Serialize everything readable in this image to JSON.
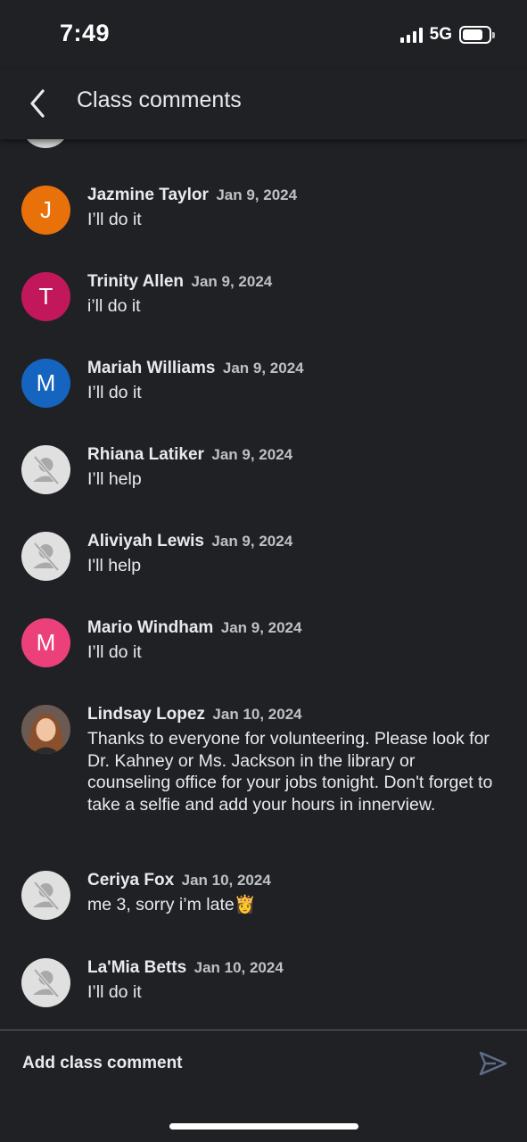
{
  "status_bar": {
    "time": "7:49",
    "network": "5G",
    "icons": [
      "signal-icon",
      "battery-icon"
    ]
  },
  "header": {
    "title": "Class comments",
    "back_icon": "chevron-left-icon"
  },
  "comments": [
    {
      "author": "Jazmine Taylor",
      "date": "Jan 9, 2024",
      "text": "I’ll do it",
      "avatar_letter": "J",
      "avatar_color": "#e8710a"
    },
    {
      "author": "Trinity Allen",
      "date": "Jan 9, 2024",
      "text": "i’ll do it",
      "avatar_letter": "T",
      "avatar_color": "#c2185b"
    },
    {
      "author": "Mariah Williams",
      "date": "Jan 9, 2024",
      "text": "I’ll do it",
      "avatar_letter": "M",
      "avatar_color": "#1565c0"
    },
    {
      "author": "Rhiana Latiker",
      "date": "Jan 9, 2024",
      "text": "I’ll help",
      "avatar_icon": "no-photo-icon"
    },
    {
      "author": "Aliviyah Lewis",
      "date": "Jan 9, 2024",
      "text": "I'll help",
      "avatar_icon": "no-photo-icon"
    },
    {
      "author": "Mario Windham",
      "date": "Jan 9, 2024",
      "text": "I’ll do it",
      "avatar_letter": "M",
      "avatar_color": "#ec407a"
    },
    {
      "author": "Lindsay Lopez",
      "date": "Jan 10, 2024",
      "text": "Thanks to everyone for volunteering.  Please look for Dr. Kahney or Ms. Jackson in the library or counseling office for your jobs tonight.  Don't forget to take a selfie and add your hours in innerview.",
      "avatar_icon": "profile-photo"
    },
    {
      "author": "Ceriya Fox",
      "date": "Jan 10, 2024",
      "text": "me 3, sorry i’m late👸",
      "avatar_icon": "no-photo-icon"
    },
    {
      "author": "La'Mia Betts",
      "date": "Jan 10, 2024",
      "text": "I’ll do it",
      "avatar_icon": "no-photo-icon"
    }
  ],
  "composer": {
    "placeholder": "Add class comment",
    "send_icon": "send-icon"
  },
  "colors": {
    "background": "#202124",
    "text": "#e8eaed",
    "date_text": "#bdc1c6",
    "divider": "#5f6368",
    "send_icon": "#5f6d8c"
  }
}
